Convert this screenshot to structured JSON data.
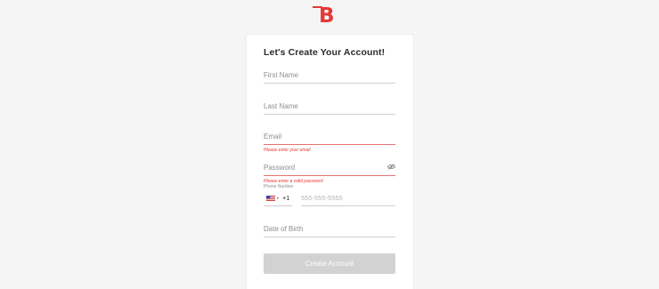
{
  "brand": {
    "logo_letter": "B",
    "accent_color": "#e53935"
  },
  "form": {
    "title": "Let's Create Your Account!",
    "first_name": {
      "placeholder": "First Name",
      "value": ""
    },
    "last_name": {
      "placeholder": "Last Name",
      "value": ""
    },
    "email": {
      "placeholder": "Email",
      "value": "",
      "error": "Please enter your email"
    },
    "password": {
      "placeholder": "Password",
      "value": "",
      "error": "Please enter a valid password",
      "toggle_icon": "eye-slash-icon"
    },
    "phone": {
      "label": "Phone Number",
      "country_flag": "us-flag-icon",
      "dial_code": "+1",
      "placeholder": "555-555-5555",
      "value": ""
    },
    "dob": {
      "placeholder": "Date of Birth",
      "value": ""
    },
    "submit_label": "Create Account"
  }
}
